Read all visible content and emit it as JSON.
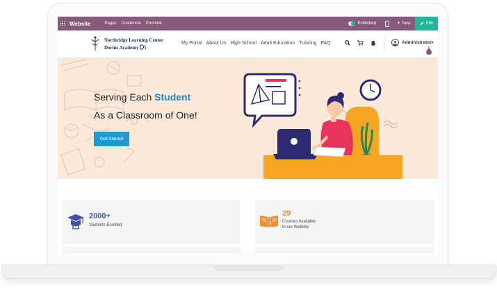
{
  "admin_bar": {
    "app_name": "Website",
    "menu": [
      "Pages",
      "Customize",
      "Promote"
    ],
    "published_label": "Published",
    "new_label": "New",
    "edit_label": "Edit"
  },
  "header": {
    "logo_line1": "Northridge Learning Center",
    "logo_line2": "Dorius Academy",
    "nav": [
      "My Portal",
      "About Us",
      "High School",
      "Adult Education",
      "Tutoring",
      "FAQ"
    ],
    "user_name": "Administrator"
  },
  "hero": {
    "line1_prefix": "Serving Each ",
    "line1_accent": "Student",
    "line2": "As a Classroom of One!",
    "cta_label": "Get Started"
  },
  "stats": [
    {
      "number": "2000+",
      "label": "Students Enrolled",
      "icon": "graduation-cap-icon"
    },
    {
      "number": "29",
      "label_line1": "Courses Available",
      "label_line2": "in our Website",
      "icon": "open-book-icon"
    }
  ],
  "colors": {
    "admin_bar": "#875a7b",
    "edit_button": "#21b799",
    "hero_bg": "#fde9d9",
    "accent_blue": "#1d86c8",
    "cta_blue": "#1d9bd8",
    "stat_purple": "#4250a5",
    "stat_orange": "#f58a2e"
  }
}
